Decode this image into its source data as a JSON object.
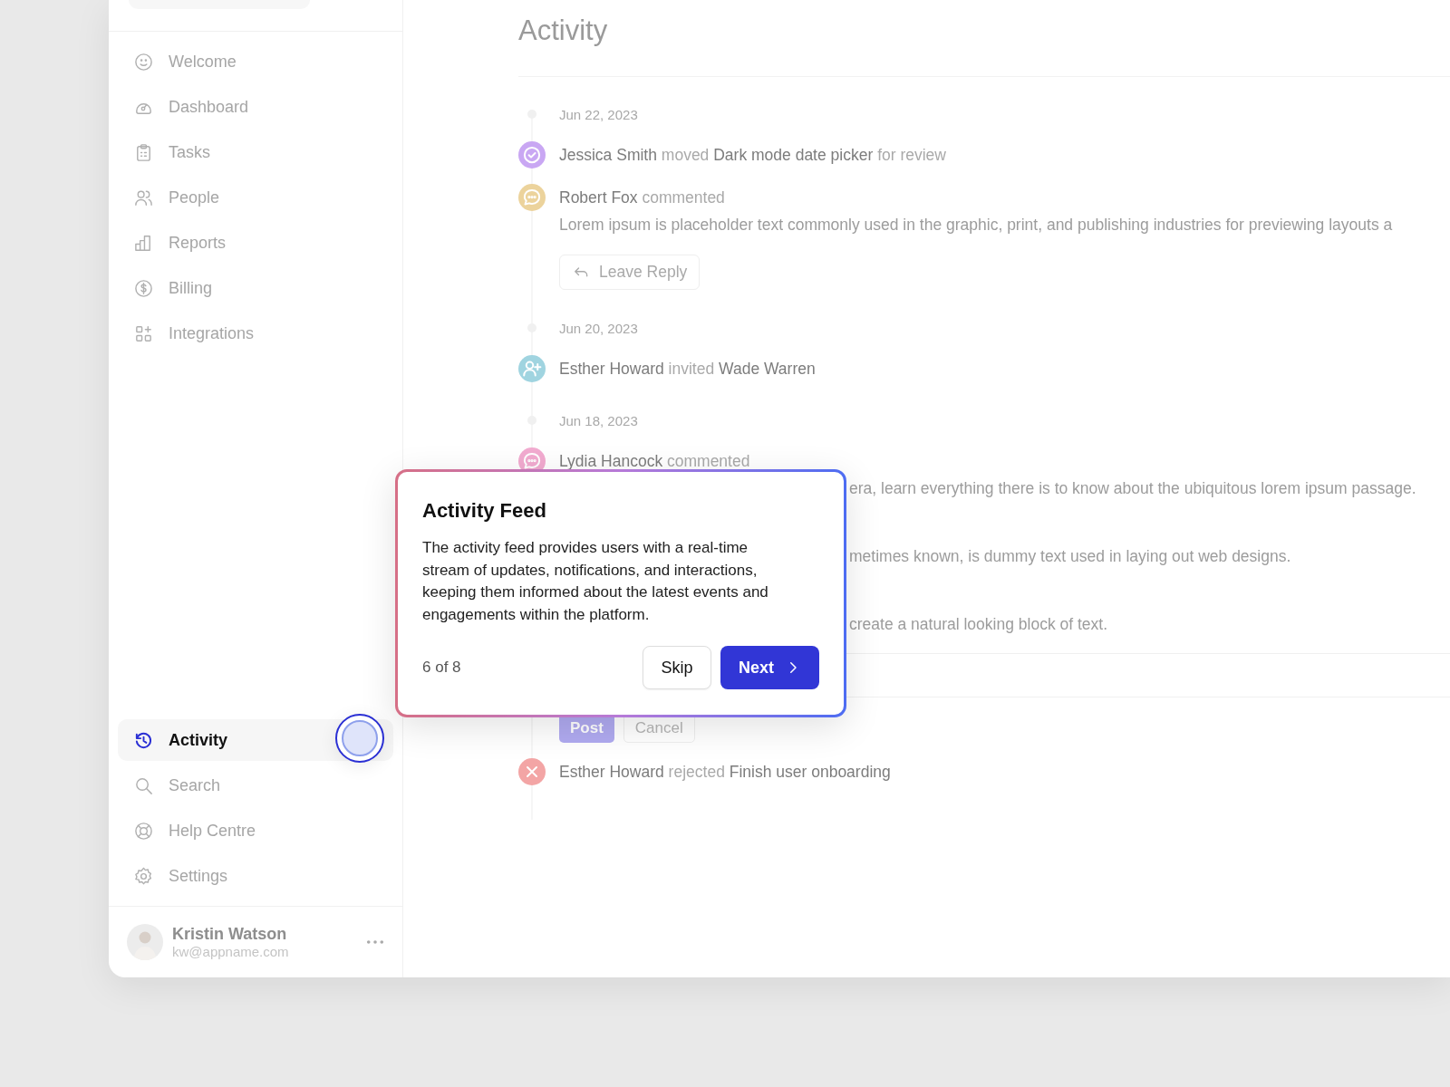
{
  "sidebar": {
    "nav_items": [
      {
        "label": "Welcome",
        "selected": false
      },
      {
        "label": "Dashboard",
        "selected": false
      },
      {
        "label": "Tasks",
        "selected": false
      },
      {
        "label": "People",
        "selected": false
      },
      {
        "label": "Reports",
        "selected": false
      },
      {
        "label": "Billing",
        "selected": false
      },
      {
        "label": "Integrations",
        "selected": false
      }
    ],
    "bottom_items": [
      {
        "label": "Activity",
        "selected": true
      },
      {
        "label": "Search",
        "selected": false
      },
      {
        "label": "Help Centre",
        "selected": false
      },
      {
        "label": "Settings",
        "selected": false
      }
    ],
    "user": {
      "name": "Kristin Watson",
      "email": "kw@appname.com"
    }
  },
  "main": {
    "title": "Activity",
    "feed": [
      {
        "kind": "date",
        "text": "Jun 22, 2023"
      },
      {
        "kind": "moved",
        "color": "#c9a7f3",
        "text": "**Jessica Smith** moved **Dark mode date picker** for review"
      },
      {
        "kind": "commented",
        "color": "#ecd39c",
        "text": "**Robert Fox** commented",
        "comment": "Lorem ipsum is placeholder text commonly used in the graphic, print, and publishing industries for previewing layouts a",
        "reply_button": "Leave Reply"
      },
      {
        "kind": "date",
        "text": "Jun 20, 2023"
      },
      {
        "kind": "invited",
        "color": "#a0d4e0",
        "text": "**Esther Howard** invited **Wade Warren**"
      },
      {
        "kind": "date",
        "text": "Jun 18, 2023"
      },
      {
        "kind": "commented",
        "color": "#f2abd0",
        "text": "**Lydia Hancock** commented",
        "covered_comment": [
          "era, learn everything there is to know about the ubiquitous lorem ipsum passage.",
          "metimes known, is dummy text used in laying out web designs.",
          "create a natural looking block of text."
        ],
        "composer": {
          "post": "Post",
          "cancel": "Cancel"
        }
      },
      {
        "kind": "rejected",
        "color": "#f3a5a5",
        "text": "**Esther Howard** rejected **Finish user onboarding**"
      }
    ]
  },
  "tour": {
    "title": "Activity Feed",
    "body": "The activity feed provides users with a real-time stream of updates, notifications, and interactions, keeping them informed about the latest events and engagements within the platform.",
    "step": "6 of 8",
    "skip": "Skip",
    "next": "Next"
  }
}
